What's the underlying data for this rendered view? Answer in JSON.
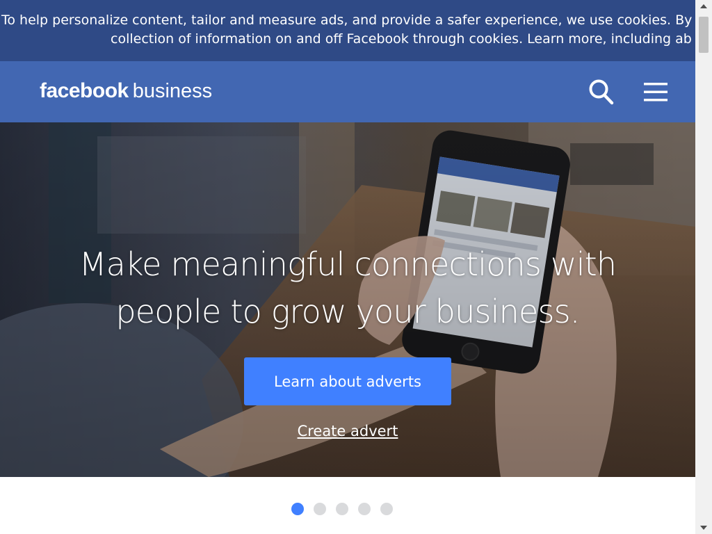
{
  "cookie_banner": {
    "line1": "To help personalize content, tailor and measure ads, and provide a safer experience, we use cookies. By",
    "line2": "collection of information on and off Facebook through cookies. Learn more, including ab"
  },
  "header": {
    "brand": "facebook",
    "sub_brand": "business",
    "search_icon": "search-icon",
    "menu_icon": "hamburger-menu-icon",
    "background": "#4267b2"
  },
  "hero": {
    "title_line1": "Make meaningful connections with",
    "title_line2": "people to grow your business.",
    "cta_label": "Learn about adverts",
    "cta_color": "#4080ff",
    "secondary_link": "Create advert"
  },
  "carousel": {
    "total": 5,
    "active_index": 0,
    "active_color": "#4080ff",
    "inactive_color": "#d9dadc"
  },
  "colors": {
    "banner": "#2f4a86",
    "header": "#4267b2"
  }
}
